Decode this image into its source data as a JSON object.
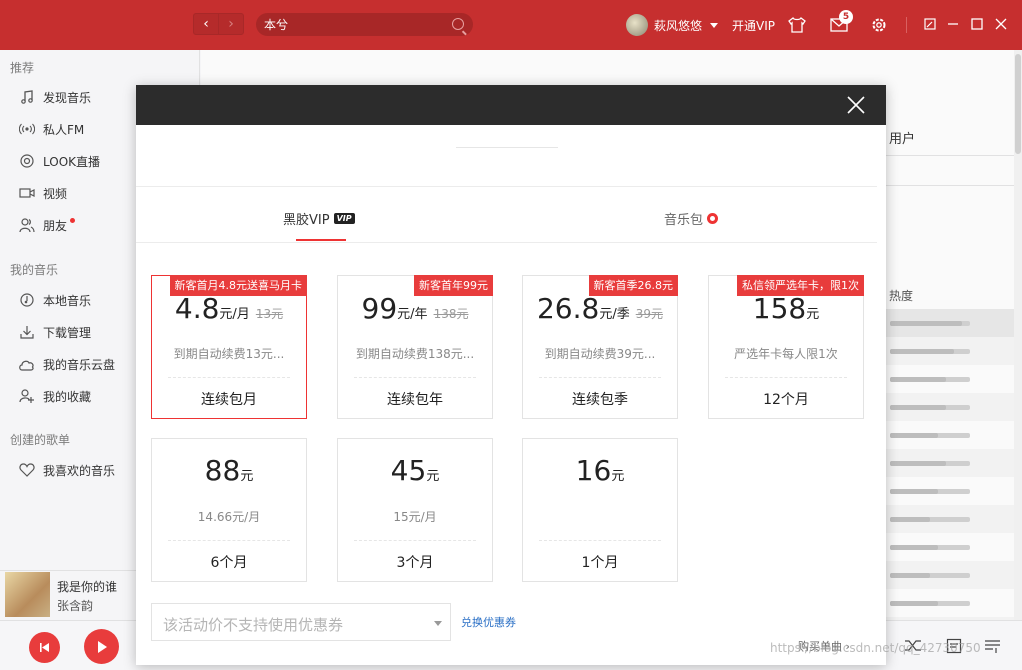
{
  "search": {
    "value": "本兮"
  },
  "user": {
    "name": "萩风悠悠",
    "open_vip": "开通VIP",
    "message_count": "5"
  },
  "sidebar": {
    "sections": [
      {
        "title": "推荐"
      },
      {
        "title": "我的音乐"
      },
      {
        "title": "创建的歌单"
      }
    ],
    "items": [
      {
        "label": "发现音乐",
        "icon": "music-note-icon"
      },
      {
        "label": "私人FM",
        "icon": "radio-icon"
      },
      {
        "label": "LOOK直播",
        "icon": "live-icon"
      },
      {
        "label": "视频",
        "icon": "video-icon"
      },
      {
        "label": "朋友",
        "icon": "friends-icon"
      },
      {
        "label": "本地音乐",
        "icon": "local-music-icon"
      },
      {
        "label": "下载管理",
        "icon": "download-icon"
      },
      {
        "label": "我的音乐云盘",
        "icon": "cloud-icon"
      },
      {
        "label": "我的收藏",
        "icon": "collection-icon"
      },
      {
        "label": "我喜欢的音乐",
        "icon": "heart-icon"
      }
    ]
  },
  "now_playing": {
    "title": "我是你的谁",
    "artist": "张含韵"
  },
  "background": {
    "users_label": "用户",
    "hot_label": "热度",
    "hot_levels": [
      0.9,
      0.8,
      0.7,
      0.7,
      0.6,
      0.7,
      0.6,
      0.5,
      0.6,
      0.5,
      0.6,
      0.5
    ]
  },
  "modal": {
    "tabs": [
      {
        "label": "黑胶VIP",
        "badge": "VIP"
      },
      {
        "label": "音乐包"
      }
    ],
    "cards": [
      {
        "badge": "新客首月4.8元送喜马月卡",
        "price": "4.8",
        "unit": "元/月",
        "old": "13元",
        "desc": "到期自动续费13元...",
        "term": "连续包月",
        "selected": true
      },
      {
        "badge": "新客首年99元",
        "price": "99",
        "unit": "元/年",
        "old": "138元",
        "desc": "到期自动续费138元...",
        "term": "连续包年"
      },
      {
        "badge": "新客首季26.8元",
        "price": "26.8",
        "unit": "元/季",
        "old": "39元",
        "desc": "到期自动续费39元...",
        "term": "连续包季"
      },
      {
        "badge": "私信领严选年卡，限1次",
        "price": "158",
        "unit": "元",
        "old": "",
        "desc": "严选年卡每人限1次",
        "term": "12个月"
      },
      {
        "badge": "",
        "price": "88",
        "unit": "元",
        "old": "",
        "desc": "14.66元/月",
        "term": "6个月"
      },
      {
        "badge": "",
        "price": "45",
        "unit": "元",
        "old": "",
        "desc": "15元/月",
        "term": "3个月"
      },
      {
        "badge": "",
        "price": "16",
        "unit": "元",
        "old": "",
        "desc": "",
        "term": "1个月"
      }
    ],
    "coupon_placeholder": "该活动价不支持使用优惠券",
    "redeem_label": "兑换优惠券",
    "buy_single_label": "购买单曲"
  },
  "watermark": "https://blog.csdn.net/qq_42730750"
}
